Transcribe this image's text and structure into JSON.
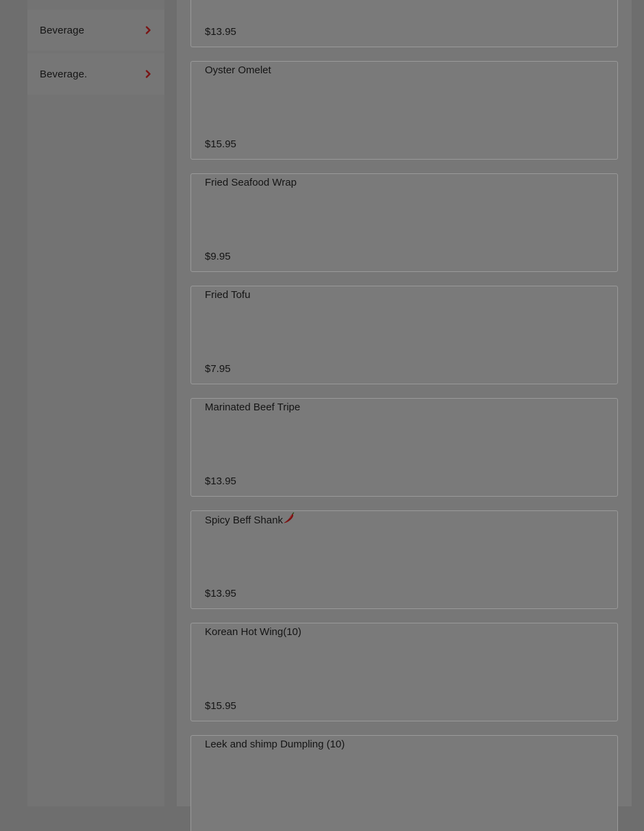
{
  "sidebar": {
    "categories": [
      {
        "label": "Beverage",
        "icon": "chevron-right-icon"
      },
      {
        "label": "Beverage.",
        "icon": "chevron-right-icon"
      }
    ]
  },
  "menu": {
    "items": [
      {
        "name": "",
        "price": "$13.95"
      },
      {
        "name": "Oyster Omelet",
        "price": "$15.95"
      },
      {
        "name": "Fried Seafood Wrap",
        "price": "$9.95"
      },
      {
        "name": "Fried Tofu",
        "price": "$7.95"
      },
      {
        "name": "Marinated Beef Tripe",
        "price": "$13.95"
      },
      {
        "name": "Spicy Beff Shank",
        "price": "$13.95",
        "spicy": true,
        "spicy_icon": "chili-pepper-icon"
      },
      {
        "name": "Korean Hot Wing(10)",
        "price": "$15.95"
      },
      {
        "name": "Leek and shimp Dumpling (10)",
        "price": ""
      }
    ]
  },
  "colors": {
    "accent": "#8b1a1a",
    "overlay_background": "#6e6e6e",
    "text": "#141414"
  }
}
